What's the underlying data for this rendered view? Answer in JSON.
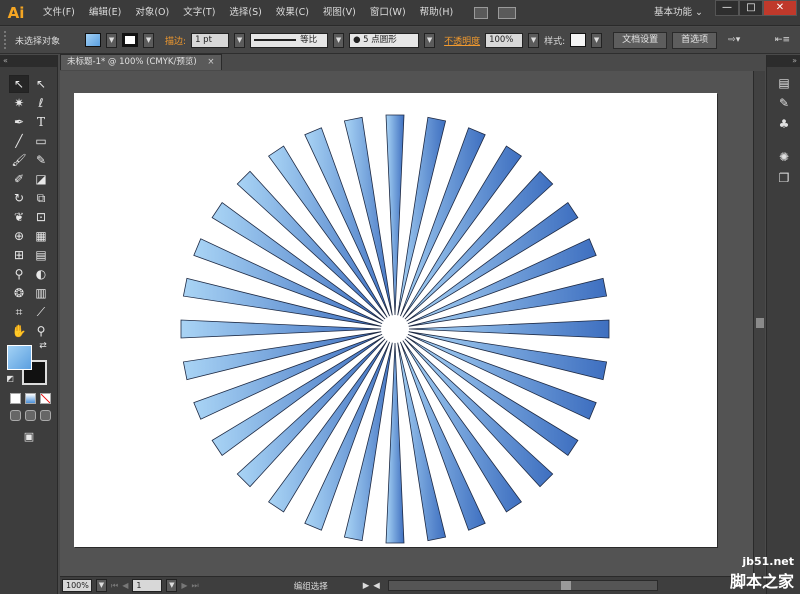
{
  "app": {
    "logo": "Ai",
    "workspace": "基本功能 ⌄"
  },
  "menu": [
    "文件(F)",
    "编辑(E)",
    "对象(O)",
    "文字(T)",
    "选择(S)",
    "效果(C)",
    "视图(V)",
    "窗口(W)",
    "帮助(H)"
  ],
  "window_controls": {
    "minimize": "—",
    "restore": "□",
    "close": "✕"
  },
  "control_bar": {
    "selection_label": "未选择对象",
    "stroke_label": "描边:",
    "stroke_weight": "1 pt",
    "profile_label": "等比",
    "brush_label": "● 5 点圆形",
    "opacity_label": "不透明度",
    "opacity_value": "100%",
    "style_label": "样式:",
    "doc_setup_button": "文档设置",
    "preferences_button": "首选项"
  },
  "document": {
    "tab_title": "未标题-1* @ 100% (CMYK/预览)",
    "close": "×"
  },
  "status_bar": {
    "zoom": "100%",
    "page": "1",
    "mode": "编组选择"
  },
  "watermark": {
    "site": "jb51.net",
    "name": "脚本之家"
  },
  "artwork": {
    "ray_count": 32,
    "gradient_light": "#a9d4f5",
    "gradient_dark": "#3e6fc0",
    "stroke": "#1e2a44"
  },
  "colors": {
    "accent": "#f29a2e",
    "fill_light": "#a3d2f5",
    "fill_dark": "#5b9fe0"
  }
}
